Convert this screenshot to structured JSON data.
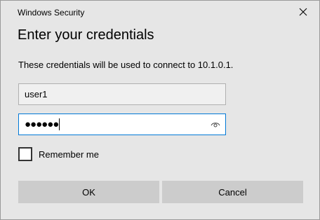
{
  "window": {
    "title": "Windows Security"
  },
  "dialog": {
    "heading": "Enter your credentials",
    "description": "These credentials will be used to connect to 10.1.0.1."
  },
  "username": {
    "value": "user1"
  },
  "password": {
    "masked_value": "●●●●●●"
  },
  "remember": {
    "label": "Remember me",
    "checked": false
  },
  "buttons": {
    "ok_label": "OK",
    "cancel_label": "Cancel"
  },
  "colors": {
    "dialog_background": "#e6e6e6",
    "focus_border": "#0078d7",
    "button_background": "#cccccc"
  },
  "icons": {
    "close": "close-icon",
    "reveal_password": "eye-icon"
  }
}
